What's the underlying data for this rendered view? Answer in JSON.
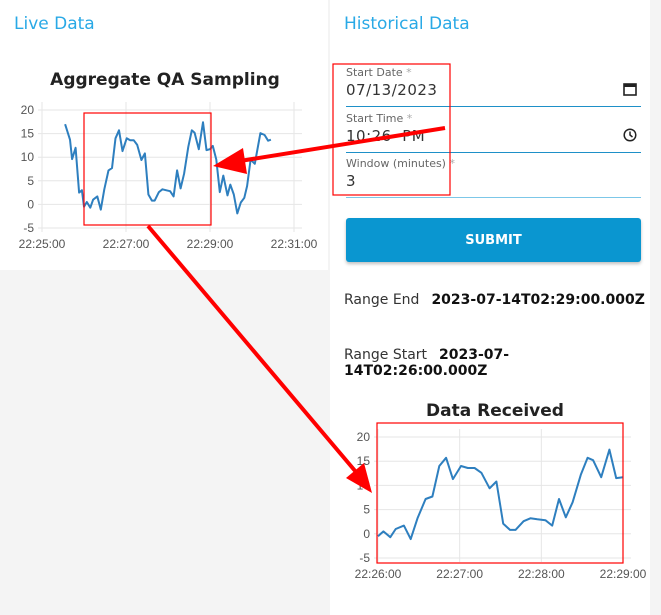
{
  "live": {
    "heading": "Live Data"
  },
  "historical": {
    "heading": "Historical Data",
    "start_date": {
      "label": "Start Date",
      "required": "*",
      "value": "07/13/2023",
      "icon": "calendar-icon"
    },
    "start_time": {
      "label": "Start Time",
      "required": "*",
      "value": "10:26  PM",
      "icon": "clock-icon"
    },
    "window": {
      "label": "Window (minutes)",
      "required": "*",
      "value": "3"
    },
    "submit_label": "SUBMIT",
    "range_end": {
      "label": "Range End",
      "value": "2023-07-14T02:29:00.000Z"
    },
    "range_start": {
      "label": "Range Start",
      "value": "2023-07-14T02:26:00.000Z"
    }
  },
  "colors": {
    "accent": "#29a9e6",
    "button": "#0a96d0",
    "line": "#2e7fbf",
    "annotation": "#ff0000"
  },
  "chart_data": [
    {
      "type": "line",
      "title": "Aggregate QA Sampling",
      "xlim": [
        "22:25:00",
        "22:31:00"
      ],
      "ylim": [
        -5,
        20
      ],
      "xticks": [
        "22:25:00",
        "22:27:00",
        "22:29:00",
        "22:31:00"
      ],
      "yticks": [
        20,
        15,
        10,
        5,
        0,
        -5
      ],
      "grid": true,
      "x": [
        "22:25:33",
        "22:25:40",
        "22:25:43",
        "22:25:48",
        "22:25:53",
        "22:25:57",
        "22:26:00",
        "22:26:04",
        "22:26:09",
        "22:26:13",
        "22:26:19",
        "22:26:24",
        "22:26:29",
        "22:26:35",
        "22:26:40",
        "22:26:45",
        "22:26:50",
        "22:26:55",
        "22:27:01",
        "22:27:06",
        "22:27:11",
        "22:27:16",
        "22:27:22",
        "22:27:27",
        "22:27:32",
        "22:27:37",
        "22:27:41",
        "22:27:47",
        "22:27:52",
        "22:27:57",
        "22:28:03",
        "22:28:08",
        "22:28:13",
        "22:28:18",
        "22:28:23",
        "22:28:29",
        "22:28:34",
        "22:28:38",
        "22:28:44",
        "22:28:50",
        "22:28:55",
        "22:29:00",
        "22:29:04",
        "22:29:09",
        "22:29:14",
        "22:29:19",
        "22:29:25",
        "22:29:29",
        "22:29:34",
        "22:29:39",
        "22:29:44",
        "22:29:49",
        "22:29:53",
        "22:29:58",
        "22:30:04",
        "22:30:12",
        "22:30:18",
        "22:30:23",
        "22:30:27"
      ],
      "y": [
        17,
        13.7,
        9.6,
        12,
        2.5,
        3,
        -0.5,
        0.5,
        -0.7,
        1,
        1.7,
        -1.1,
        3.2,
        7.2,
        7.7,
        14,
        15.7,
        11.3,
        14,
        13.6,
        13.6,
        12.6,
        9.4,
        10.8,
        2.1,
        0.8,
        0.8,
        2.6,
        3.2,
        3,
        2.8,
        1.7,
        7.2,
        3.4,
        6.5,
        12.2,
        15.7,
        15.2,
        11.7,
        17.4,
        11.5,
        11.7,
        12.4,
        9.5,
        2.6,
        6.1,
        1.9,
        4.2,
        2.1,
        -1.9,
        0.4,
        1.4,
        3.9,
        9.5,
        8.6,
        15.1,
        14.7,
        13.5,
        13.7
      ]
    },
    {
      "type": "line",
      "title": "Data Received",
      "xlim": [
        "22:26:00",
        "22:29:00"
      ],
      "ylim": [
        -5,
        20
      ],
      "xticks": [
        "22:26:00",
        "22:27:00",
        "22:28:00",
        "22:29:00"
      ],
      "yticks": [
        20,
        15,
        10,
        5,
        0,
        -5
      ],
      "grid": true,
      "x": [
        "22:26:00",
        "22:26:04",
        "22:26:09",
        "22:26:13",
        "22:26:19",
        "22:26:24",
        "22:26:29",
        "22:26:35",
        "22:26:40",
        "22:26:45",
        "22:26:50",
        "22:26:55",
        "22:27:01",
        "22:27:06",
        "22:27:11",
        "22:27:16",
        "22:27:22",
        "22:27:27",
        "22:27:32",
        "22:27:37",
        "22:27:41",
        "22:27:47",
        "22:27:52",
        "22:27:57",
        "22:28:03",
        "22:28:08",
        "22:28:13",
        "22:28:18",
        "22:28:23",
        "22:28:29",
        "22:28:34",
        "22:28:38",
        "22:28:44",
        "22:28:50",
        "22:28:55",
        "22:29:00"
      ],
      "y": [
        -0.5,
        0.5,
        -0.7,
        1,
        1.7,
        -1.1,
        3.2,
        7.2,
        7.7,
        14,
        15.7,
        11.3,
        14,
        13.6,
        13.6,
        12.6,
        9.4,
        10.8,
        2.1,
        0.8,
        0.8,
        2.6,
        3.2,
        3,
        2.8,
        1.7,
        7.2,
        3.4,
        6.5,
        12.2,
        15.7,
        15.2,
        11.7,
        17.4,
        11.5,
        11.7
      ]
    }
  ]
}
